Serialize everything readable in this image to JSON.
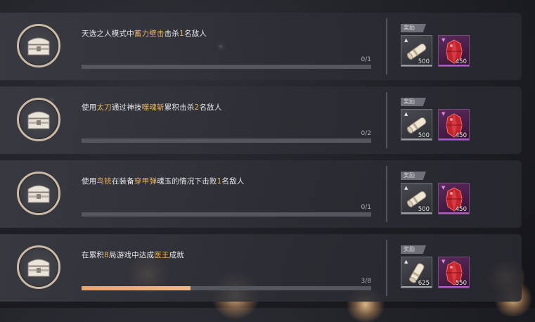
{
  "tasks": [
    {
      "desc_parts": [
        {
          "text": "天选之人模式中",
          "hl": false
        },
        {
          "text": "蓄力壁击",
          "hl": true
        },
        {
          "text": "击杀",
          "hl": false
        },
        {
          "text": "1",
          "hl": true
        },
        {
          "text": "名敌人",
          "hl": false
        }
      ],
      "progress_text": "0/1",
      "progress": 0,
      "reward_tag": "奖励",
      "rewards": [
        {
          "icon": "scroll-icon",
          "amount": "500"
        },
        {
          "icon": "red-gem-icon",
          "amount": "450"
        }
      ]
    },
    {
      "desc_parts": [
        {
          "text": "使用",
          "hl": false
        },
        {
          "text": "太刀",
          "hl": true
        },
        {
          "text": "通过神技",
          "hl": false
        },
        {
          "text": "噬魂斩",
          "hl": true
        },
        {
          "text": "累积击杀",
          "hl": false
        },
        {
          "text": "2",
          "hl": true
        },
        {
          "text": "名敌人",
          "hl": false
        }
      ],
      "progress_text": "0/2",
      "progress": 0,
      "reward_tag": "奖励",
      "rewards": [
        {
          "icon": "scroll-icon",
          "amount": "500"
        },
        {
          "icon": "red-gem-icon",
          "amount": "450"
        }
      ]
    },
    {
      "desc_parts": [
        {
          "text": "使用",
          "hl": false
        },
        {
          "text": "鸟铳",
          "hl": true
        },
        {
          "text": "在装备",
          "hl": false
        },
        {
          "text": "穿甲弹",
          "hl": true
        },
        {
          "text": "魂玉的情况下击败",
          "hl": false
        },
        {
          "text": "1",
          "hl": true
        },
        {
          "text": "名敌人",
          "hl": false
        }
      ],
      "progress_text": "0/1",
      "progress": 0,
      "reward_tag": "奖励",
      "rewards": [
        {
          "icon": "scroll-icon",
          "amount": "500"
        },
        {
          "icon": "red-gem-icon",
          "amount": "450"
        }
      ]
    },
    {
      "desc_parts": [
        {
          "text": "在累积",
          "hl": false
        },
        {
          "text": "8",
          "hl": true
        },
        {
          "text": "局游戏中达成",
          "hl": false
        },
        {
          "text": "医王",
          "hl": true
        },
        {
          "text": "成就",
          "hl": false
        }
      ],
      "progress_text": "3/8",
      "progress": 0.375,
      "reward_tag": "奖励",
      "rewards": [
        {
          "icon": "scroll-icon",
          "amount": "625"
        },
        {
          "icon": "red-gem-icon",
          "amount": "550"
        }
      ]
    }
  ],
  "colors": {
    "highlight": "#e7b35c",
    "progress_fill": "#e9a36f",
    "gem_border": "#b05ad0"
  }
}
